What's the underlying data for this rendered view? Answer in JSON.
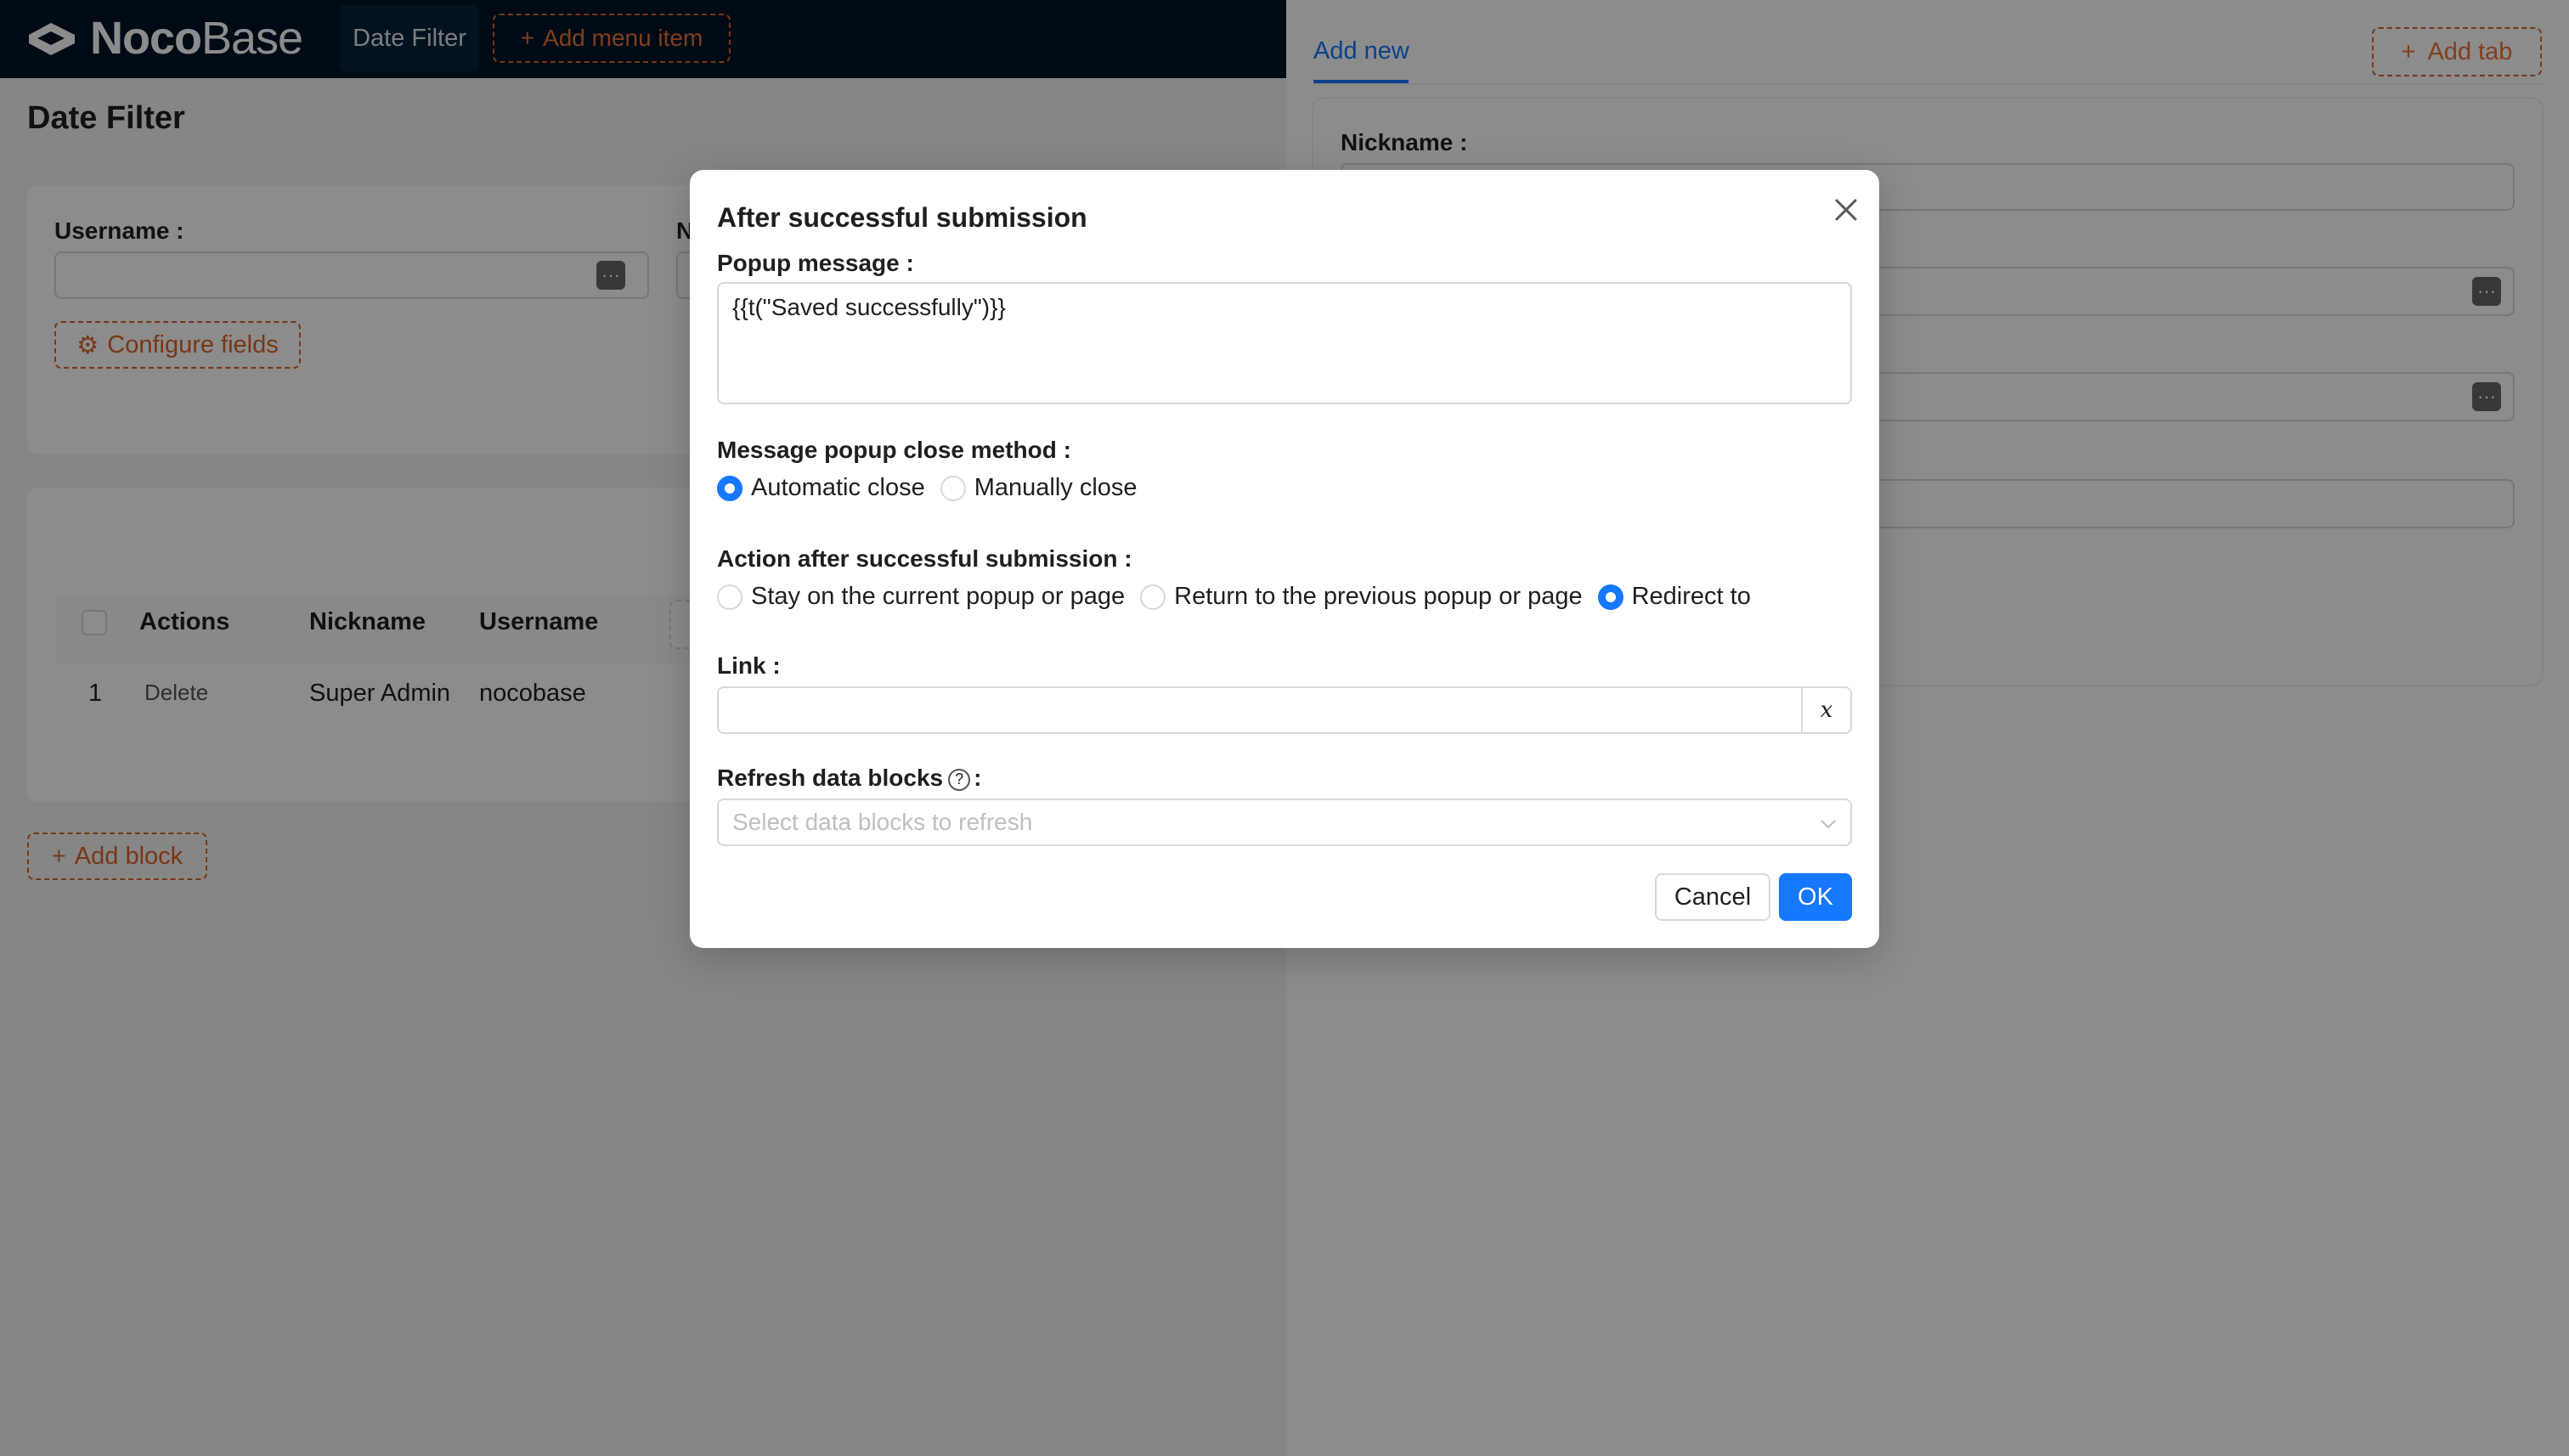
{
  "app": {
    "logo": {
      "text_bold": "Noco",
      "text_light": "Base"
    },
    "top_tab": "Date Filter",
    "add_menu_item": "Add menu item"
  },
  "page": {
    "title": "Date Filter",
    "filter_form": {
      "username_label": "Username",
      "second_label_partial": "N",
      "configure_fields": "Configure fields"
    },
    "table": {
      "headers": [
        "Actions",
        "Nickname",
        "Username"
      ],
      "rows": [
        {
          "index": "1",
          "action": "Delete",
          "nickname": "Super Admin",
          "username": "nocobase"
        }
      ]
    },
    "add_block": "Add block"
  },
  "drawer": {
    "tab_label": "Add new",
    "add_tab": "Add tab",
    "nickname_label": "Nickname"
  },
  "modal": {
    "title": "After successful submission",
    "popup_message": {
      "label": "Popup message",
      "value": "{{t(\"Saved successfully\")}}"
    },
    "close_method": {
      "label": "Message popup close method",
      "options": [
        "Automatic close",
        "Manually close"
      ],
      "selected": "Automatic close"
    },
    "action_after": {
      "label": "Action after successful submission",
      "options": [
        "Stay on the current popup or page",
        "Return to the previous popup or page",
        "Redirect to"
      ],
      "selected": "Redirect to"
    },
    "link": {
      "label": "Link",
      "value": "",
      "variable_button": "x"
    },
    "refresh": {
      "label": "Refresh data blocks",
      "placeholder": "Select data blocks to refresh"
    },
    "cancel": "Cancel",
    "ok": "OK"
  },
  "colors": {
    "primary": "#1677ff",
    "dashed_accent": "#d9652b",
    "topbar": "#001529"
  }
}
